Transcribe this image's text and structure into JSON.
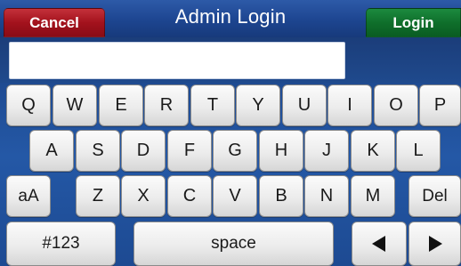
{
  "header": {
    "title": "Admin Login",
    "cancel_label": "Cancel",
    "login_label": "Login"
  },
  "input": {
    "value": "",
    "placeholder": ""
  },
  "keyboard": {
    "row1": [
      "Q",
      "W",
      "E",
      "R",
      "T",
      "Y",
      "U",
      "I",
      "O",
      "P"
    ],
    "row2": [
      "A",
      "S",
      "D",
      "F",
      "G",
      "H",
      "J",
      "K",
      "L"
    ],
    "row3_left": "aA",
    "row3": [
      "Z",
      "X",
      "C",
      "V",
      "B",
      "N",
      "M"
    ],
    "row3_right": "Del",
    "row4": {
      "symbols": "#123",
      "space": "space"
    },
    "arrows": [
      "left-arrow-icon",
      "right-arrow-icon"
    ]
  },
  "colors": {
    "cancel": "#a3121d",
    "login": "#0f6f2b",
    "background": "#1d4590"
  }
}
